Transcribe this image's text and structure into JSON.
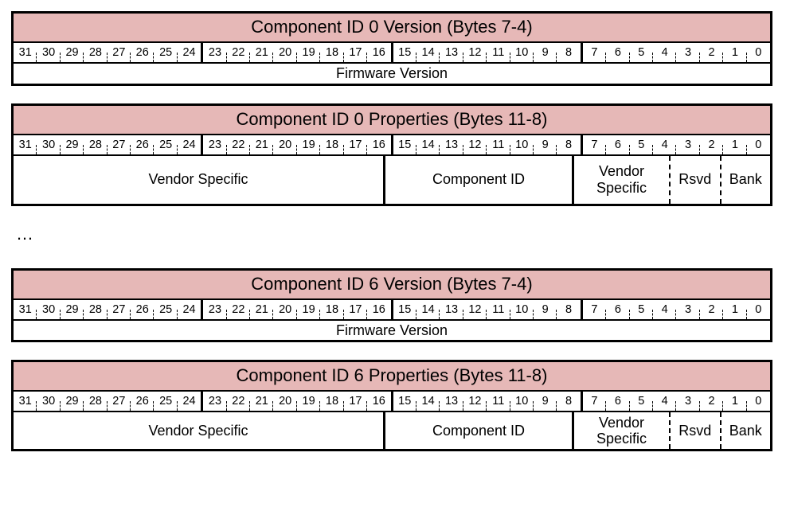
{
  "bits": [
    "31",
    "30",
    "29",
    "28",
    "27",
    "26",
    "25",
    "24",
    "23",
    "22",
    "21",
    "20",
    "19",
    "18",
    "17",
    "16",
    "15",
    "14",
    "13",
    "12",
    "11",
    "10",
    "9",
    "8",
    "7",
    "6",
    "5",
    "4",
    "3",
    "2",
    "1",
    "0"
  ],
  "ellipsis": "…",
  "tables": [
    {
      "title": "Component ID 0 Version (Bytes 7-4)",
      "row_variant": "short",
      "fields": [
        {
          "label": "Firmware Version",
          "span": 32,
          "sep": "none"
        }
      ]
    },
    {
      "title": "Component ID 0 Properties (Bytes 11-8)",
      "row_variant": "tall",
      "fields": [
        {
          "label": "Vendor Specific",
          "span": 16,
          "sep": "solid"
        },
        {
          "label": "Component ID",
          "span": 8,
          "sep": "solid"
        },
        {
          "label": "Vendor Specific",
          "span": 4,
          "sep": "dash"
        },
        {
          "label": "Rsvd",
          "span": 2,
          "sep": "dash"
        },
        {
          "label": "Bank",
          "span": 2,
          "sep": "none"
        }
      ]
    },
    {
      "title": "Component ID 6 Version (Bytes 7-4)",
      "row_variant": "short",
      "fields": [
        {
          "label": "Firmware Version",
          "span": 32,
          "sep": "none"
        }
      ]
    },
    {
      "title": "Component ID 6 Properties (Bytes 11-8)",
      "row_variant": "med",
      "fields": [
        {
          "label": "Vendor Specific",
          "span": 16,
          "sep": "solid"
        },
        {
          "label": "Component ID",
          "span": 8,
          "sep": "solid"
        },
        {
          "label": "Vendor Specific",
          "span": 4,
          "sep": "dash"
        },
        {
          "label": "Rsvd",
          "span": 2,
          "sep": "dash"
        },
        {
          "label": "Bank",
          "span": 2,
          "sep": "none"
        }
      ]
    }
  ]
}
